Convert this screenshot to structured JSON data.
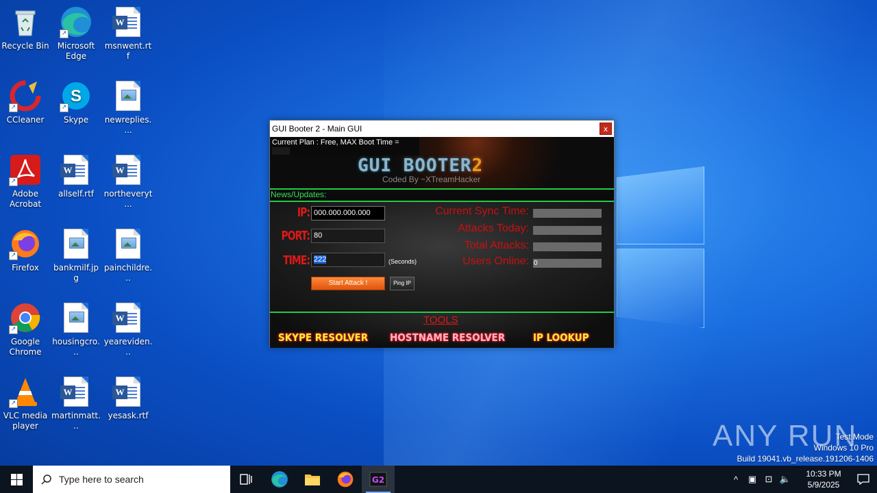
{
  "desktop": {
    "icons": [
      {
        "label": "Recycle Bin"
      },
      {
        "label": "Microsoft Edge"
      },
      {
        "label": "msnwent.rtf"
      },
      {
        "label": "CCleaner"
      },
      {
        "label": "Skype"
      },
      {
        "label": "newreplies...."
      },
      {
        "label": "Adobe Acrobat"
      },
      {
        "label": "allself.rtf"
      },
      {
        "label": "northeveryt..."
      },
      {
        "label": "Firefox"
      },
      {
        "label": "bankmilf.jpg"
      },
      {
        "label": "painchildre..."
      },
      {
        "label": "Google Chrome"
      },
      {
        "label": "housingcro..."
      },
      {
        "label": "yeareviden..."
      },
      {
        "label": "VLC media player"
      },
      {
        "label": "martinmatt..."
      },
      {
        "label": "yesask.rtf"
      }
    ]
  },
  "app": {
    "title": "GUI Booter 2 - Main GUI",
    "close_label": "x",
    "plan_text": "Current Plan : Free,  MAX Boot Time =",
    "logo_text": "GUI BOOTER",
    "logo_num": "2",
    "logo_sub": "Coded By ~XTreamHacker",
    "news_label": "News/Updates:",
    "ip_label": "IP:",
    "ip_value": "000.000.000.000",
    "port_label": "PORT:",
    "port_value": "80",
    "time_label": "TIME:",
    "time_value": "222",
    "seconds_label": "(Seconds)",
    "start_button": "Start Attack !",
    "ping_button": "Ping IP",
    "stats": [
      {
        "label": "Current Sync Time:",
        "value": ""
      },
      {
        "label": "Attacks Today:",
        "value": ""
      },
      {
        "label": "Total Attacks:",
        "value": ""
      },
      {
        "label": "Users Online:",
        "value": "0"
      }
    ],
    "tools_title": "TOOLS",
    "tools": [
      "SKYPE RESOLVER",
      "HOSTNAME RESOLVER",
      "IP LOOKUP"
    ]
  },
  "watermark": {
    "brand": "ANY RUN",
    "line1": "Test Mode",
    "line2": "Windows 10 Pro",
    "line3": "Build 19041.vb_release.191206-1406"
  },
  "taskbar": {
    "search_placeholder": "Type here to search",
    "time": "10:33 PM",
    "date": "5/9/2025"
  },
  "colors": {
    "accent_green": "#22cc44",
    "label_red": "#e01818",
    "button_orange": "#e0530e",
    "tool_yellow": "#f0f030",
    "tool_pink": "#ffb0c8"
  }
}
